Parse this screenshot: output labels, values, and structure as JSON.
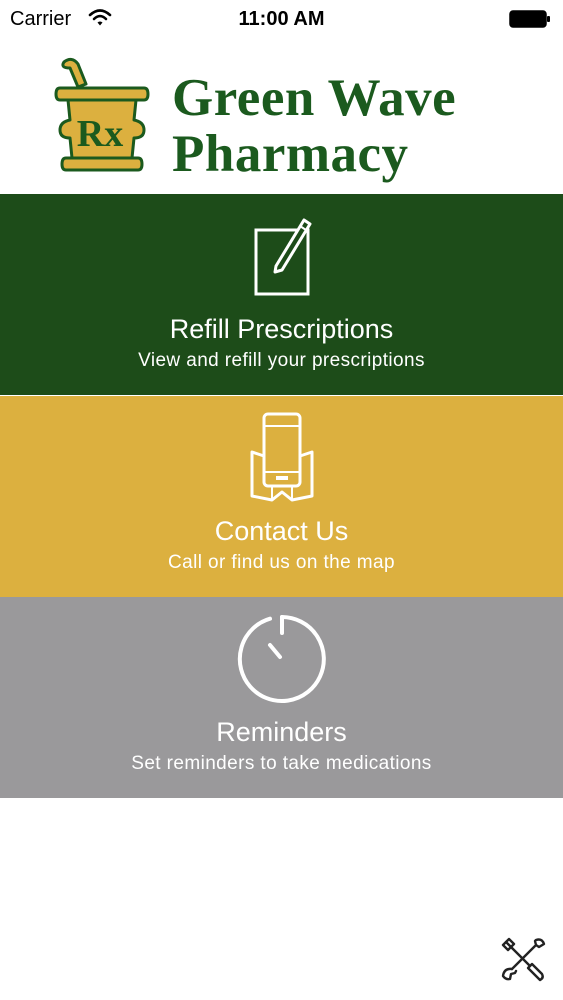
{
  "status_bar": {
    "carrier": "Carrier",
    "time": "11:00 AM"
  },
  "header": {
    "logo_line1": "Green Wave",
    "logo_line2": "Pharmacy",
    "logo_mark_text": "Rx",
    "brand_color": "#1b5a1e",
    "logo_gold": "#dcb03f"
  },
  "tiles": [
    {
      "title": "Refill Prescriptions",
      "subtitle": "View and refill your prescriptions",
      "icon": "notepad-pencil-icon",
      "color": "#1d4c19"
    },
    {
      "title": "Contact Us",
      "subtitle": "Call or find us on the map",
      "icon": "phone-map-icon",
      "color": "#dcb03f"
    },
    {
      "title": "Reminders",
      "subtitle": "Set reminders to take medications",
      "icon": "timer-icon",
      "color": "#9a999b"
    }
  ],
  "footer": {
    "settings_icon": "wrench-screwdriver-icon"
  }
}
